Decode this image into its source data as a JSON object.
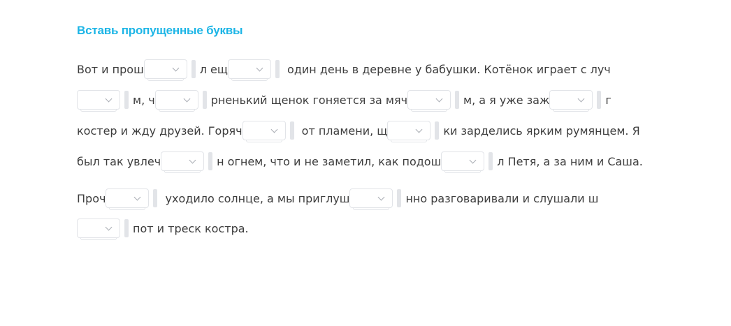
{
  "title": "Вставь пропущенные буквы",
  "lines": [
    [
      "Вот и прош",
      null,
      "л ещ",
      null,
      " один день в деревне у бабушки. Котёнок играет с луч"
    ],
    [
      null,
      "м, ч",
      null,
      "рненький щенок гоняется за мяч",
      null,
      "м, а я уже заж",
      null,
      "г"
    ],
    [
      "костер и жду друзей. Горяч",
      null,
      " от пламени, щ",
      null,
      "ки зарделись ярким румянцем. Я"
    ],
    [
      "был так увлеч",
      null,
      "н огнем, что и не заметил, как подош",
      null,
      "л Петя, а за ним и Саша."
    ],
    [
      "Проч",
      null,
      " уходило солнце, а мы приглуш",
      null,
      "нно разговаривали и слушали ш"
    ],
    [
      null,
      "пот и треск костра."
    ]
  ]
}
